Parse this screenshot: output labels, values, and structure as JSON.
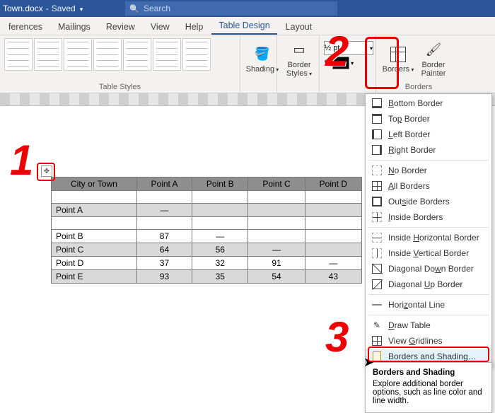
{
  "title": {
    "name": "Town.docx",
    "status": "Saved"
  },
  "search": {
    "placeholder": "Search"
  },
  "tabs": [
    "ferences",
    "Mailings",
    "Review",
    "View",
    "Help",
    "Table Design",
    "Layout"
  ],
  "active_tab": "Table Design",
  "ribbon": {
    "shading": "Shading",
    "border_styles": "Border Styles",
    "pen_weight": "½ pt",
    "borders": "Borders",
    "painter_l1": "Border",
    "painter_l2": "Painter",
    "group_styles": "Table Styles",
    "group_borders": "Borders"
  },
  "menu": {
    "bottom": "Bottom Border",
    "top": "Top Border",
    "left": "Left Border",
    "right": "Right Border",
    "no": "No Border",
    "all": "All Borders",
    "outside": "Outside Borders",
    "inside": "Inside Borders",
    "ihorz": "Inside Horizontal Border",
    "ivert": "Inside Vertical Border",
    "ddown": "Diagonal Down Border",
    "dup": "Diagonal Up Border",
    "hline": "Horizontal Line",
    "draw": "Draw Table",
    "grid": "View Gridlines",
    "bs": "Borders and Shading…"
  },
  "tooltip": {
    "title": "Borders and Shading",
    "body": "Explore additional border options, such as line color and line width."
  },
  "callouts": {
    "one": "1",
    "two": "2",
    "three": "3"
  },
  "table": {
    "headers": [
      "City or Town",
      "Point A",
      "Point B",
      "Point C",
      "Point D"
    ],
    "rows": [
      {
        "label": "",
        "cells": [
          "",
          "",
          "",
          ""
        ]
      },
      {
        "label": "Point A",
        "cells": [
          "—",
          "",
          "",
          ""
        ]
      },
      {
        "label": "",
        "cells": [
          "",
          "",
          "",
          ""
        ]
      },
      {
        "label": "Point B",
        "cells": [
          "87",
          "—",
          "",
          ""
        ]
      },
      {
        "label": "Point C",
        "cells": [
          "64",
          "56",
          "—",
          ""
        ]
      },
      {
        "label": "Point D",
        "cells": [
          "37",
          "32",
          "91",
          "—"
        ]
      },
      {
        "label": "Point E",
        "cells": [
          "93",
          "35",
          "54",
          "43"
        ]
      }
    ]
  }
}
